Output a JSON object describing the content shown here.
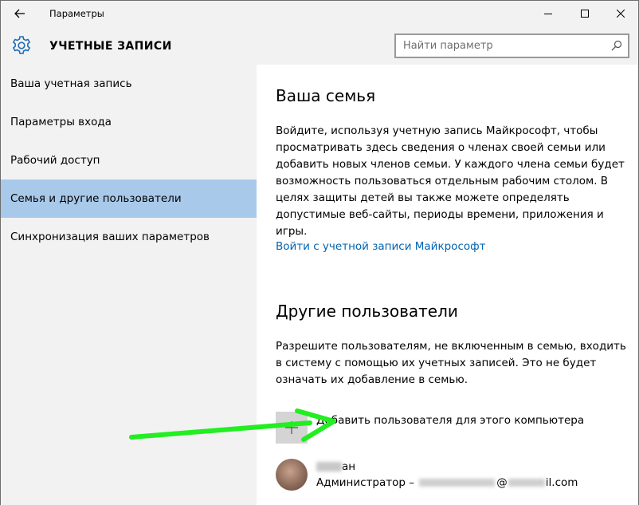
{
  "window": {
    "title": "Параметры",
    "back_icon": "arrow-left-icon",
    "controls": [
      "minimize-icon",
      "maximize-icon",
      "close-icon"
    ]
  },
  "header": {
    "icon": "gear-icon",
    "title": "УЧЕТНЫЕ ЗАПИСИ",
    "search_placeholder": "Найти параметр"
  },
  "sidebar": {
    "items": [
      {
        "label": "Ваша учетная запись",
        "selected": false
      },
      {
        "label": "Параметры входа",
        "selected": false
      },
      {
        "label": "Рабочий доступ",
        "selected": false
      },
      {
        "label": "Семья и другие пользователи",
        "selected": true
      },
      {
        "label": "Синхронизация ваших параметров",
        "selected": false
      }
    ]
  },
  "main": {
    "family": {
      "heading": "Ваша семья",
      "text": "Войдите, используя учетную запись Майкрософт, чтобы просматривать здесь сведения о членах своей семьи или добавить новых членов семьи. У каждого члена семьи будет возможность пользоваться отдельным рабочим столом. В целях защиты детей вы также можете определять допустимые веб-сайты, периоды времени, приложения и игры.",
      "link": "Войти с учетной записи Майкрософт"
    },
    "others": {
      "heading": "Другие пользователи",
      "text": "Разрешите пользователям, не включенным в семью, входить в систему с помощью их учетных записей. Это не будет означать их добавление в семью.",
      "add_label": "Добавить пользователя для этого компьютера",
      "user": {
        "name_visible": "ан",
        "role_prefix": "Администратор –",
        "email_at": "@",
        "email_suffix": "il.com"
      }
    }
  },
  "colors": {
    "selected_bg": "#a8c9ea",
    "link": "#0063b1",
    "arrow": "#22ee22",
    "chrome_bg": "#f2f2f2"
  }
}
